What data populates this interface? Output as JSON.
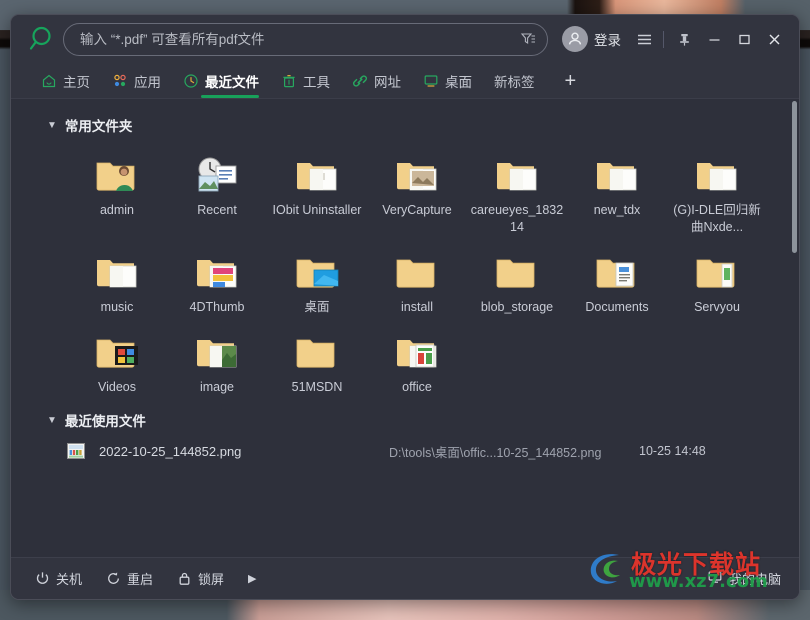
{
  "window": {
    "search": {
      "placeholder": "输入 “*.pdf” 可查看所有pdf文件",
      "value": "",
      "filter_icon": "filter-icon",
      "logo_icon": "magnifier-logo-icon"
    },
    "titlebar": {
      "login_label": "登录",
      "avatar_icon": "user-avatar-icon",
      "menu_icon": "hamburger-menu-icon",
      "pin_icon": "pin-icon",
      "minimize_icon": "minimize-icon",
      "maximize_icon": "maximize-icon",
      "close_icon": "close-icon"
    },
    "accent_color": "#18a05a",
    "background_color": "#2e303b",
    "chrome_color": "#32343f"
  },
  "tabs": [
    {
      "label": "主页",
      "icon": "home-icon",
      "active": false
    },
    {
      "label": "应用",
      "icon": "apps-icon",
      "active": false
    },
    {
      "label": "最近文件",
      "icon": "clock-icon",
      "active": true
    },
    {
      "label": "工具",
      "icon": "trash-icon",
      "active": false
    },
    {
      "label": "网址",
      "icon": "link-icon",
      "active": false
    },
    {
      "label": "桌面",
      "icon": "monitor-icon",
      "active": false
    },
    {
      "label": "新标签",
      "icon": "",
      "active": false
    }
  ],
  "tab_add_label": "+",
  "sections": {
    "folders": {
      "title": "常用文件夹",
      "expanded": true,
      "items": [
        {
          "label": "admin",
          "icon": "folder-user-icon"
        },
        {
          "label": "Recent",
          "icon": "recent-clock-docs-icon"
        },
        {
          "label": "IObit Uninstaller",
          "icon": "folder-doc-icon"
        },
        {
          "label": "VeryCapture",
          "icon": "folder-image-icon"
        },
        {
          "label": "careueyes_183214",
          "icon": "folder-open-icon"
        },
        {
          "label": "new_tdx",
          "icon": "folder-open-icon"
        },
        {
          "label": "(G)I-DLE回归新曲Nxde...",
          "icon": "folder-open-icon"
        },
        {
          "label": "music",
          "icon": "folder-open-icon"
        },
        {
          "label": "4DThumb",
          "icon": "folder-thumbs-icon"
        },
        {
          "label": "桌面",
          "icon": "folder-desktop-icon"
        },
        {
          "label": "install",
          "icon": "folder-plain-icon"
        },
        {
          "label": "blob_storage",
          "icon": "folder-plain-icon"
        },
        {
          "label": "Documents",
          "icon": "folder-documents-icon"
        },
        {
          "label": "Servyou",
          "icon": "folder-files-icon"
        },
        {
          "label": "Videos",
          "icon": "folder-videos-icon"
        },
        {
          "label": "image",
          "icon": "folder-photo-icon"
        },
        {
          "label": "51MSDN",
          "icon": "folder-plain-icon"
        },
        {
          "label": "office",
          "icon": "folder-office-icon"
        }
      ]
    },
    "recent_files": {
      "title": "最近使用文件",
      "expanded": true,
      "rows": [
        {
          "icon": "png-thumbnail-icon",
          "name": "2022-10-25_144852.png",
          "path": "D:\\tools\\桌面\\offic...10-25_144852.png",
          "time": "10-25 14:48"
        }
      ]
    }
  },
  "footer": {
    "buttons": [
      {
        "label": "关机",
        "icon": "power-icon"
      },
      {
        "label": "重启",
        "icon": "restart-icon"
      },
      {
        "label": "锁屏",
        "icon": "lock-icon"
      }
    ],
    "more_icon": "triangle-right-icon",
    "my_computer": {
      "label": "我的电脑",
      "icon": "monitor-icon"
    }
  },
  "watermark": {
    "text": "极光下载站",
    "url": "www.xz7.com",
    "logo_icon": "aurora-swirl-logo-icon"
  }
}
